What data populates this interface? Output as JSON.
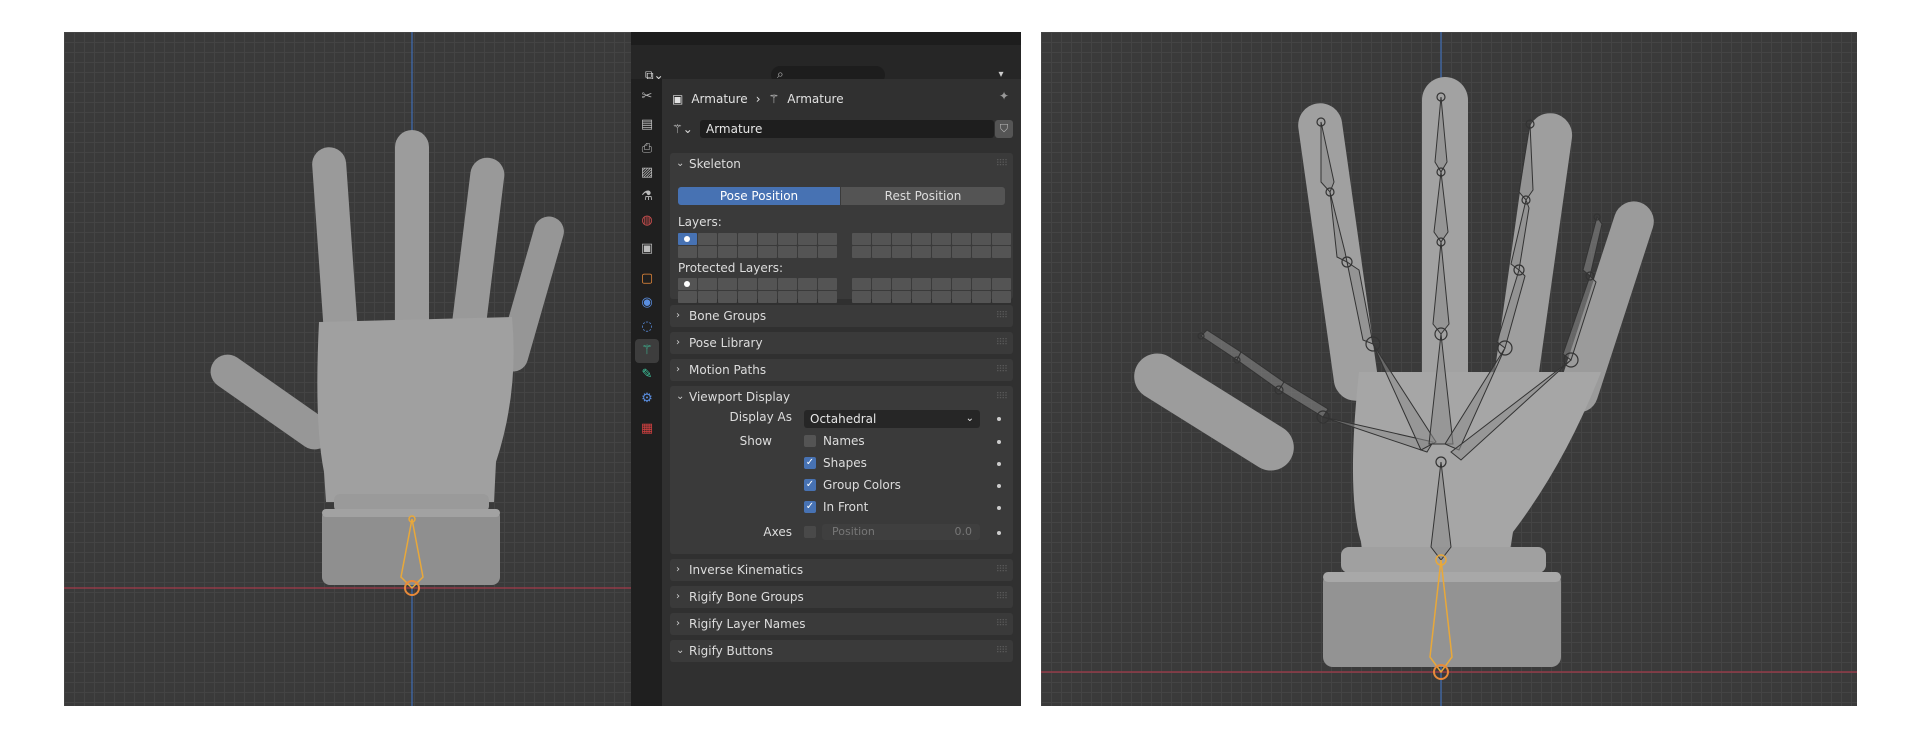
{
  "properties_editor": {
    "search_placeholder": "",
    "breadcrumb": {
      "object": "Armature",
      "separator": "›",
      "data": "Armature"
    },
    "datablock_name": "Armature",
    "panels": {
      "skeleton": {
        "title": "Skeleton",
        "pose_position": "Pose Position",
        "rest_position": "Rest Position",
        "selected_position": "Pose Position",
        "layers_label": "Layers:",
        "protected_layers_label": "Protected Layers:"
      },
      "bone_groups": "Bone Groups",
      "pose_library": "Pose Library",
      "motion_paths": "Motion Paths",
      "viewport_display": {
        "title": "Viewport Display",
        "display_as_label": "Display As",
        "display_as_value": "Octahedral",
        "show_label": "Show",
        "names": {
          "label": "Names",
          "checked": false
        },
        "shapes": {
          "label": "Shapes",
          "checked": true
        },
        "group_colors": {
          "label": "Group Colors",
          "checked": true
        },
        "in_front": {
          "label": "In Front",
          "checked": true
        },
        "axes_label": "Axes",
        "axes": {
          "checked": false
        },
        "position_label": "Position",
        "position_value": "0.0"
      },
      "inverse_kinematics": "Inverse Kinematics",
      "rigify_bone_groups": "Rigify Bone Groups",
      "rigify_layer_names": "Rigify Layer Names",
      "rigify_buttons": "Rigify Buttons"
    }
  },
  "tab_icons": [
    "tool-icon",
    "render-icon",
    "output-icon",
    "view-layer-icon",
    "scene-icon",
    "world-icon",
    "collection-icon",
    "object-icon",
    "modifier-icon",
    "particles-icon",
    "physics-icon",
    "armature-data-icon",
    "bone-icon",
    "bone-constraint-icon",
    "texture-icon"
  ],
  "colors": {
    "active": "#4772b3",
    "bone_selected": "#e8a83a",
    "viewport_bg": "#3a3a3a",
    "x_axis": "#a33a4a",
    "y_axis": "#3d6bb3"
  }
}
